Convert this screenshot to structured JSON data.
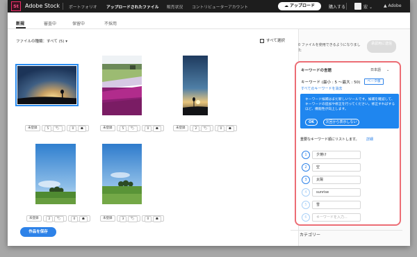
{
  "header": {
    "logo": "St",
    "brand": "Adobe Stock",
    "nav": [
      "ポートフォリオ",
      "アップロードされたファイル",
      "販売状況",
      "コントリビューターアカウント"
    ],
    "upload_label": "アップロード",
    "buy_label": "購入する",
    "user_name": "宏",
    "user_menu_glyph": "⌄",
    "adobe_label": "Adobe"
  },
  "tabs": [
    "新規",
    "審査中",
    "保留中",
    "不採用"
  ],
  "filter": {
    "label": "ファイルの種類：すべて (5)",
    "caret": "▾"
  },
  "select_all_label": "すべて選択",
  "files": [
    {
      "status": "未登録",
      "keyword_count": "5",
      "tag_glyph": "🏷",
      "people_count": "0"
    },
    {
      "status": "未登録",
      "keyword_count": "5",
      "tag_glyph": "🏷",
      "people_count": "0"
    },
    {
      "status": "未登録",
      "keyword_count": "2",
      "tag_glyph": "🏷",
      "people_count": "0"
    },
    {
      "status": "未登録",
      "keyword_count": "2",
      "tag_glyph": "🏷",
      "people_count": "0"
    },
    {
      "status": "未登録",
      "keyword_count": "3",
      "tag_glyph": "🏷",
      "people_count": "0"
    }
  ],
  "save_label": "作品を保存",
  "panel": {
    "available_text": "0 ファイルを使用できるようになりました",
    "apply_label": "承認用に送信",
    "language_title": "キーワードの言語",
    "language_value": "日本語",
    "language_caret": "⌄",
    "keywords_title": "キーワード (最小 : 5 〜最大 : 50)",
    "beta_label": "ベータ版",
    "clear_link": "すべてのキーワードを消去",
    "info_text": "キーワード候補はまだ新しいツールです。候補を確認して、キーワードの追加や修正を行ってください。修正すればするほど、機能性が向上します。",
    "info_ok": "OK",
    "info_dismiss": "次回から表示しない",
    "important_label": "重要なキーワード順にリストします。",
    "detail_link": "詳細",
    "keywords": [
      {
        "num": "1",
        "text": "夕焼け"
      },
      {
        "num": "2",
        "text": "空"
      },
      {
        "num": "3",
        "text": "太陽"
      },
      {
        "num": "4",
        "text": "sunrise"
      },
      {
        "num": "5",
        "text": "雪"
      }
    ],
    "next_num": "6",
    "keyword_placeholder": "キーワードを入力...",
    "category_label": "カテゴリー"
  },
  "colors": {
    "accent": "#2d82e8",
    "highlight": "#ec6c74",
    "topbar": "#1d1d1d"
  }
}
